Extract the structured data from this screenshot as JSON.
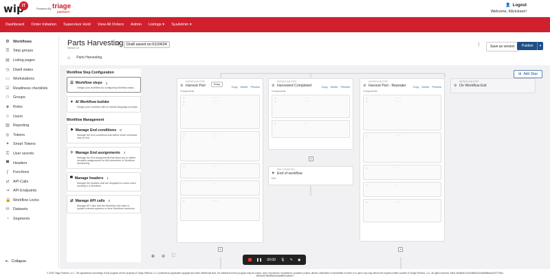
{
  "header": {
    "logo_text": "wip",
    "logo_badge": "IT",
    "powered_by": "Powered By",
    "brand": "triage",
    "brand_sub": "partners",
    "logout_label": "Logout",
    "welcome": "Welcome, KErickson!"
  },
  "nav": {
    "items": [
      "Dashboard",
      "Order Initiation",
      "Supervisor Hold",
      "View All Orders",
      "Admin",
      "Listings ▾",
      "SysAdmin ▾"
    ]
  },
  "sidebar": {
    "items": [
      "Workflows",
      "Step groups",
      "Listing pages",
      "Dwell states",
      "Workstations",
      "Readiness checklists",
      "Groups",
      "Roles",
      "Users",
      "Reporting",
      "Tokens",
      "Smart Tokens",
      "User secrets",
      "Headers",
      "Functions",
      "API Calls",
      "API Endpoints",
      "Workflow Locks",
      "Datasets",
      "Segments"
    ],
    "collapse_label": "Collapse"
  },
  "page": {
    "title": "Parts Harvesting",
    "draft_label": "Draft saved on 01/24/24",
    "version": "Version 10",
    "breadcrumb_tab": "Parts Harvesting",
    "save_version_label": "Save as version",
    "publish_label": "Publish",
    "add_step_label": "Add Step"
  },
  "panel": {
    "config_heading": "Workflow Step Configuration",
    "mgmt_heading": "Workflow Management",
    "options": [
      {
        "title": "Workflow steps",
        "count": "3",
        "desc": "Design your workflow by configuring Workflow steps"
      },
      {
        "title": "AI Workflow builder",
        "count": "",
        "desc": "Design your workflow with AI natural language prompts"
      }
    ],
    "mgmt": [
      {
        "title": "Manage End conditions",
        "count": "8",
        "desc": "Manage the End conditions that define which Workflow step is next"
      },
      {
        "title": "Manage End assignments",
        "count": "2",
        "desc": "Manage the End assignments that allow you to define reusable assignments for AM interaction or Workflow decisioning"
      },
      {
        "title": "Manage headers",
        "count": "1",
        "desc": "Manage the headers that are displayed to users when working in a Workflow"
      },
      {
        "title": "Manage API calls",
        "count": "0",
        "desc": "Manage API calls that the Workflow will make to update external systems or drive Workflow decisions"
      }
    ]
  },
  "cards": {
    "card1": {
      "sub": "WORKFLOW STEP",
      "title": "Harvest Part",
      "chip": "Entry",
      "label": "Components"
    },
    "card2": {
      "sub": "WORKFLOW STEP",
      "title": "Harvested Completed",
      "label": "Components"
    },
    "card3": {
      "sub": "WORKFLOW STEP",
      "title": "Harvest Part - Repeater",
      "label": "Components"
    },
    "card4": {
      "sub": "WORKFLOW STEP",
      "title": "On Workflow Exit"
    },
    "end": {
      "sub": "END CONDITION",
      "title": "End of workflow",
      "label": "Exit"
    },
    "actions": [
      "Copy",
      "Delete",
      "Preview"
    ]
  },
  "recorder": {
    "time": "00:00"
  },
  "footer": {
    "line1": "© 2025 Triage Partners, LLC. The appearance and design of this program are the property of Triage Partners, LLC protected by applicable copyright and other intellectual laws. No material from this program may be copied, used, reproduced, republished, uploaded, posted, altered, distributed or transmitted in whole or in part in any way without the express written consent of Triage Partners, LLC. All rights reserved. Build: #6a8b4b7b-b94d8ef3c2ec6fa8f8deacc57f77fab1",
    "line2": "b6e5c3d7b5e8f0a2b4c6d8e0f1a3b5c7"
  }
}
